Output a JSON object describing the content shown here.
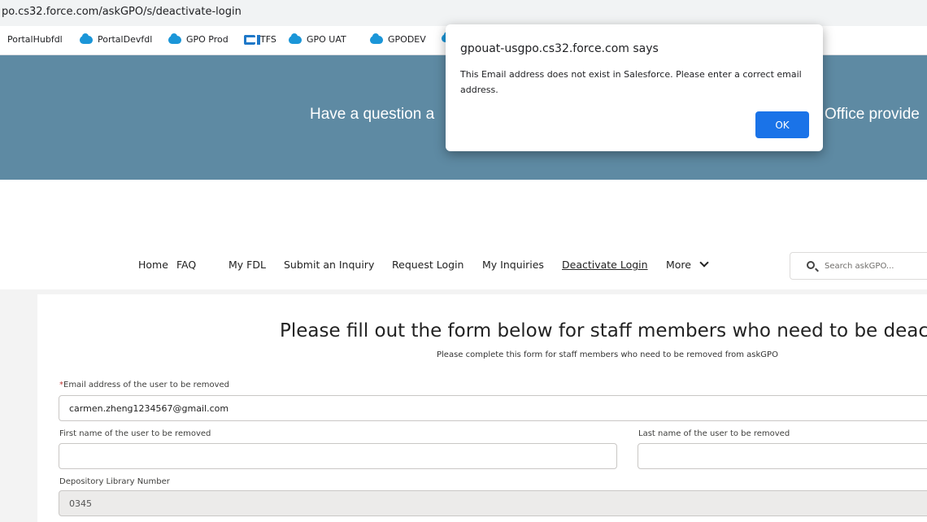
{
  "browser": {
    "url": "po.cs32.force.com/askGPO/s/deactivate-login",
    "bookmarks": [
      {
        "label": "PortalHubfdl",
        "icon": "none"
      },
      {
        "label": "PortalDevfdl",
        "icon": "salesforce-cloud-icon"
      },
      {
        "label": "GPO Prod",
        "icon": "salesforce-cloud-icon"
      },
      {
        "label": "TFS",
        "icon": "tfs-icon"
      },
      {
        "label": "GPO UAT",
        "icon": "salesforce-cloud-icon"
      },
      {
        "label": "GPODEV",
        "icon": "salesforce-cloud-icon"
      }
    ]
  },
  "hero": {
    "text_left": "Have a question a",
    "text_right": "Office provide"
  },
  "nav": {
    "items": [
      "Home",
      "FAQ",
      "My FDL",
      "Submit an Inquiry",
      "Request Login",
      "My Inquiries",
      "Deactivate Login",
      "More"
    ],
    "active": "Deactivate Login",
    "search_placeholder": "Search askGPO..."
  },
  "form": {
    "title": "Please fill out the form below for staff members who need to be deactiv",
    "subtitle": "Please complete this form for staff members who need to be removed from askGPO",
    "email_label": "Email address of the user to be removed",
    "required_mark": "*",
    "email_value": "carmen.zheng1234567@gmail.com",
    "first_name_label": "First name of the user to be removed",
    "first_name_value": "",
    "last_name_label": "Last name of the user to be removed",
    "last_name_value": "",
    "library_label": "Depository Library Number",
    "library_value": "0345"
  },
  "dialog": {
    "title": "gpouat-usgpo.cs32.force.com says",
    "message": "This Email address does not exist in Salesforce. Please enter a correct email address.",
    "ok_label": "OK"
  },
  "colors": {
    "hero_bg": "#5e8aa3",
    "ok_button": "#1a73e8",
    "salesforce_cloud": "#1b96d8",
    "required": "#c23934"
  }
}
